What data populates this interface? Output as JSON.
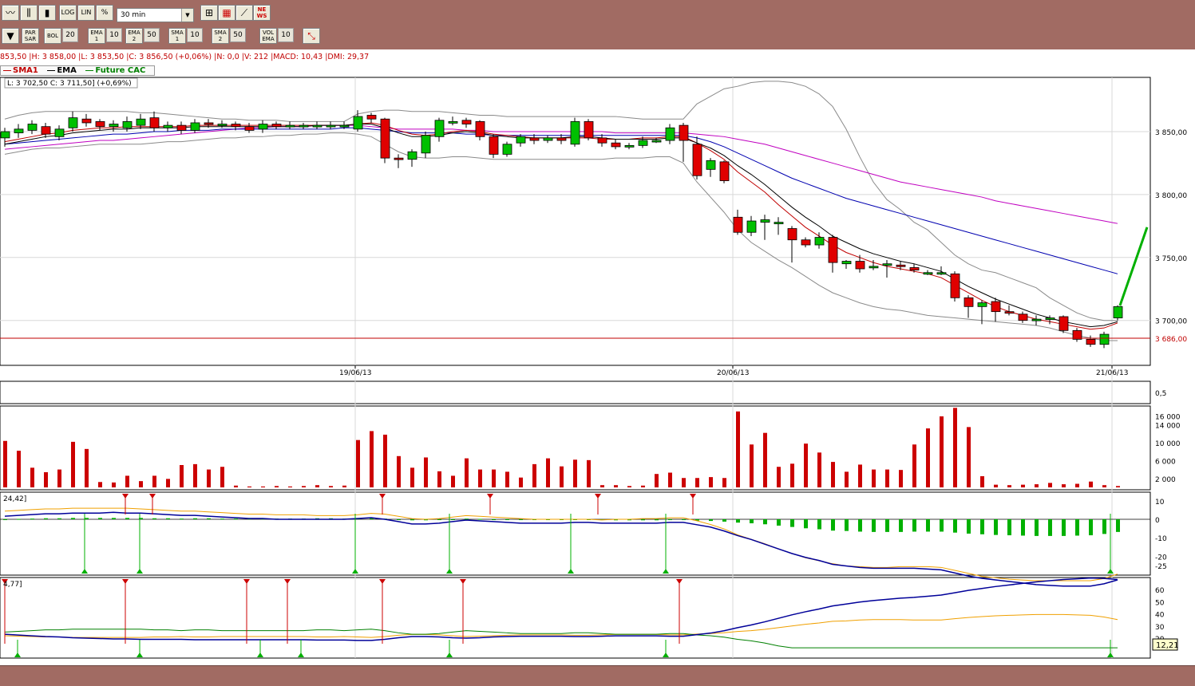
{
  "toolbar1": {
    "chart_type_icons": [
      "line-chart-icon",
      "bar-chart-icon",
      "candlestick-icon"
    ],
    "scale_buttons": [
      "LOG",
      "LIN",
      "%"
    ],
    "period": "30 min",
    "tool_icons": [
      "zoom-chart-icon",
      "color-grid-icon",
      "compare-chart-icon",
      "news-icon"
    ],
    "news_label": "NE WS"
  },
  "toolbar2": {
    "indicators": [
      {
        "label": "PAR SAR",
        "value": ""
      },
      {
        "label": "BOL",
        "value": "20"
      },
      {
        "label": "EMA 1",
        "value": "10"
      },
      {
        "label": "EMA 2",
        "value": "50"
      },
      {
        "label": "SMA 1",
        "value": "10"
      },
      {
        "label": "SMA 2",
        "value": "50"
      },
      {
        "label": "VOL EMA",
        "value": "10"
      }
    ]
  },
  "info_line": "853,50 |H: 3 858,00 |L: 3 853,50 |C: 3 856,50 (+0,06%) |N: 0,0 |V: 212 |MACD: 10,43 |DMI: 29,37",
  "legend": {
    "sma": "SMA1",
    "ema": "EMA",
    "future": "Future CAC"
  },
  "tooltip": "L: 3 702,50  C: 3 711,50] (+0,69%)",
  "colors": {
    "up": "#00c000",
    "down": "#e00000",
    "sma": "#c00000",
    "ema": "#000000",
    "ma50": "#c000c0",
    "ma_blue": "#0000b0",
    "macd": "#000099",
    "signal": "#f0a000",
    "dmi_plus": "#008000"
  },
  "price_axis": {
    "ticks": [
      "3 850,00",
      "3 800,00",
      "3 750,00",
      "3 700,00"
    ],
    "last_price": "3 686,00"
  },
  "dates": [
    "19/06/13",
    "20/06/13",
    "21/06/13"
  ],
  "osc_panel_label": "0,5",
  "volume_axis": [
    "16 000",
    "14 000",
    "10 000",
    "6 000",
    "2 000"
  ],
  "macd_panel": {
    "label": "24,42]",
    "ticks": [
      "10",
      "0",
      "-10",
      "-20",
      "-25"
    ]
  },
  "dmi_panel": {
    "label": "4,77]",
    "ticks": [
      "60",
      "50",
      "40",
      "30",
      "20"
    ],
    "value_box": "12,21"
  },
  "chart_data": {
    "type": "candlestick",
    "candles": [
      [
        3845,
        3850,
        3838,
        3853
      ],
      [
        3849,
        3852,
        3845,
        3856
      ],
      [
        3851,
        3856,
        3848,
        3859
      ],
      [
        3854,
        3848,
        3845,
        3857
      ],
      [
        3846,
        3852,
        3843,
        3855
      ],
      [
        3853,
        3861,
        3850,
        3866
      ],
      [
        3860,
        3857,
        3854,
        3864
      ],
      [
        3858,
        3854,
        3851,
        3860
      ],
      [
        3854,
        3856,
        3850,
        3859
      ],
      [
        3853,
        3858,
        3850,
        3862
      ],
      [
        3855,
        3860,
        3852,
        3864
      ],
      [
        3861,
        3853,
        3850,
        3866
      ],
      [
        3853,
        3855,
        3850,
        3858
      ],
      [
        3855,
        3851,
        3848,
        3858
      ],
      [
        3851,
        3857,
        3849,
        3860
      ],
      [
        3857,
        3856,
        3853,
        3860
      ],
      [
        3856,
        3856,
        3853,
        3859
      ],
      [
        3856,
        3854,
        3851,
        3858
      ],
      [
        3854,
        3851,
        3849,
        3857
      ],
      [
        3852,
        3856,
        3849,
        3859
      ],
      [
        3856,
        3854,
        3852,
        3858
      ],
      [
        3855,
        3855,
        3852,
        3858
      ],
      [
        3855,
        3855,
        3852,
        3857
      ],
      [
        3855,
        3855,
        3852,
        3858
      ],
      [
        3855,
        3855,
        3852,
        3858
      ],
      [
        3855,
        3855,
        3852,
        3858
      ],
      [
        3852,
        3862,
        3850,
        3867
      ],
      [
        3863,
        3860,
        3857,
        3865
      ],
      [
        3860,
        3829,
        3825,
        3861
      ],
      [
        3829,
        3828,
        3821,
        3832
      ],
      [
        3828,
        3834,
        3822,
        3836
      ],
      [
        3833,
        3847,
        3829,
        3850
      ],
      [
        3846,
        3859,
        3842,
        3861
      ],
      [
        3858,
        3858,
        3855,
        3862
      ],
      [
        3859,
        3856,
        3853,
        3861
      ],
      [
        3858,
        3846,
        3843,
        3859
      ],
      [
        3846,
        3832,
        3829,
        3848
      ],
      [
        3832,
        3840,
        3830,
        3842
      ],
      [
        3841,
        3846,
        3838,
        3848
      ],
      [
        3845,
        3843,
        3840,
        3848
      ],
      [
        3843,
        3845,
        3841,
        3847
      ],
      [
        3845,
        3843,
        3840,
        3848
      ],
      [
        3840,
        3858,
        3838,
        3861
      ],
      [
        3858,
        3845,
        3843,
        3860
      ],
      [
        3845,
        3841,
        3838,
        3848
      ],
      [
        3841,
        3838,
        3836,
        3844
      ],
      [
        3838,
        3839,
        3836,
        3841
      ],
      [
        3839,
        3843,
        3837,
        3846
      ],
      [
        3843,
        3843,
        3841,
        3845
      ],
      [
        3843,
        3853,
        3840,
        3856
      ],
      [
        3855,
        3843,
        3826,
        3857
      ],
      [
        3840,
        3815,
        3812,
        3846
      ],
      [
        3820,
        3827,
        3814,
        3829
      ],
      [
        3826,
        3811,
        3809,
        3827
      ],
      [
        3782,
        3770,
        3768,
        3788
      ],
      [
        3770,
        3779,
        3767,
        3783
      ],
      [
        3778,
        3780,
        3764,
        3784
      ],
      [
        3778,
        3778,
        3768,
        3782
      ],
      [
        3773,
        3764,
        3746,
        3775
      ],
      [
        3764,
        3760,
        3758,
        3766
      ],
      [
        3760,
        3766,
        3757,
        3770
      ],
      [
        3766,
        3746,
        3738,
        3768
      ],
      [
        3745,
        3747,
        3741,
        3748
      ],
      [
        3747,
        3741,
        3738,
        3752
      ],
      [
        3743,
        3743,
        3740,
        3748
      ],
      [
        3745,
        3745,
        3734,
        3748
      ],
      [
        3744,
        3743,
        3740,
        3747
      ],
      [
        3742,
        3740,
        3738,
        3745
      ],
      [
        3738,
        3738,
        3736,
        3740
      ],
      [
        3738,
        3738,
        3736,
        3743
      ],
      [
        3737,
        3718,
        3715,
        3739
      ],
      [
        3718,
        3711,
        3702,
        3720
      ],
      [
        3711,
        3714,
        3697,
        3716
      ],
      [
        3715,
        3707,
        3699,
        3718
      ],
      [
        3707,
        3706,
        3704,
        3712
      ],
      [
        3705,
        3700,
        3698,
        3707
      ],
      [
        3700,
        3701,
        3696,
        3704
      ],
      [
        3701,
        3702,
        3697,
        3704
      ],
      [
        3703,
        3692,
        3690,
        3704
      ],
      [
        3692,
        3685,
        3683,
        3694
      ],
      [
        3685,
        3681,
        3679,
        3688
      ],
      [
        3681,
        3689,
        3678,
        3691
      ],
      [
        3702,
        3711,
        3700,
        3712
      ]
    ],
    "volume": [
      10400,
      8200,
      4400,
      3400,
      4000,
      10200,
      8600,
      1200,
      1100,
      2600,
      1400,
      2600,
      1900,
      5000,
      5200,
      4000,
      4600,
      400,
      200,
      200,
      300,
      200,
      300,
      500,
      300,
      400,
      10600,
      12600,
      11800,
      7000,
      4400,
      6700,
      3600,
      2600,
      6500,
      4000,
      4000,
      3500,
      2200,
      5200,
      6500,
      4700,
      6200,
      6100,
      500,
      500,
      300,
      400,
      3000,
      3300,
      2100,
      2100,
      2300,
      2100,
      17000,
      9600,
      12200,
      4600,
      5300,
      9800,
      7800,
      5700,
      3500,
      5100,
      4000,
      4000,
      3900,
      9600,
      13200,
      15900,
      17800,
      13500,
      2500,
      600,
      500,
      600,
      700,
      1000,
      700,
      800,
      1300,
      500,
      300
    ],
    "bollinger_upper": [
      3860,
      3863,
      3865,
      3866,
      3866,
      3866,
      3866,
      3866,
      3866,
      3866,
      3865,
      3865,
      3864,
      3863,
      3862,
      3861,
      3860,
      3860,
      3859,
      3859,
      3859,
      3858,
      3858,
      3858,
      3858,
      3858,
      3864,
      3866,
      3867,
      3867,
      3866,
      3866,
      3866,
      3865,
      3864,
      3863,
      3863,
      3862,
      3862,
      3862,
      3862,
      3862,
      3862,
      3862,
      3862,
      3862,
      3861,
      3860,
      3860,
      3860,
      3860,
      3872,
      3878,
      3884,
      3886,
      3889,
      3890,
      3890,
      3889,
      3886,
      3880,
      3870,
      3852,
      3830,
      3810,
      3796,
      3788,
      3778,
      3772,
      3762,
      3752,
      3745,
      3740,
      3738,
      3734,
      3730,
      3726,
      3718,
      3712,
      3706,
      3702,
      3700,
      3700
    ],
    "bollinger_lower": [
      3832,
      3834,
      3836,
      3837,
      3837,
      3838,
      3839,
      3840,
      3840,
      3840,
      3840,
      3841,
      3842,
      3842,
      3843,
      3844,
      3845,
      3845,
      3846,
      3846,
      3847,
      3847,
      3848,
      3848,
      3849,
      3849,
      3848,
      3846,
      3840,
      3834,
      3830,
      3829,
      3829,
      3830,
      3830,
      3829,
      3828,
      3828,
      3828,
      3828,
      3828,
      3828,
      3828,
      3828,
      3828,
      3829,
      3829,
      3829,
      3830,
      3830,
      3825,
      3810,
      3798,
      3786,
      3772,
      3762,
      3755,
      3748,
      3742,
      3735,
      3728,
      3722,
      3718,
      3714,
      3711,
      3709,
      3708,
      3706,
      3704,
      3703,
      3702,
      3701,
      3700,
      3699,
      3698,
      3697,
      3696,
      3694,
      3691,
      3688,
      3686,
      3684,
      3684
    ],
    "sma_red": [
      3842,
      3844,
      3846,
      3848,
      3849,
      3851,
      3852,
      3853,
      3853,
      3854,
      3854,
      3854,
      3854,
      3854,
      3855,
      3855,
      3855,
      3855,
      3855,
      3855,
      3855,
      3855,
      3855,
      3855,
      3855,
      3855,
      3856,
      3857,
      3855,
      3851,
      3848,
      3847,
      3848,
      3850,
      3851,
      3850,
      3848,
      3847,
      3846,
      3845,
      3845,
      3845,
      3845,
      3845,
      3844,
      3844,
      3844,
      3845,
      3845,
      3846,
      3846,
      3841,
      3835,
      3828,
      3818,
      3810,
      3802,
      3792,
      3783,
      3774,
      3767,
      3760,
      3754,
      3750,
      3746,
      3743,
      3741,
      3739,
      3737,
      3734,
      3728,
      3722,
      3716,
      3711,
      3707,
      3704,
      3701,
      3699,
      3697,
      3695,
      3693,
      3694,
      3698
    ],
    "ema_black": [
      3840,
      3842,
      3844,
      3846,
      3847,
      3849,
      3850,
      3851,
      3852,
      3852,
      3853,
      3853,
      3853,
      3853,
      3854,
      3854,
      3854,
      3854,
      3854,
      3854,
      3854,
      3854,
      3854,
      3855,
      3855,
      3855,
      3856,
      3856,
      3853,
      3849,
      3846,
      3846,
      3847,
      3849,
      3850,
      3849,
      3847,
      3846,
      3845,
      3845,
      3845,
      3845,
      3846,
      3846,
      3845,
      3844,
      3844,
      3844,
      3844,
      3845,
      3845,
      3841,
      3837,
      3831,
      3823,
      3816,
      3808,
      3799,
      3790,
      3782,
      3775,
      3767,
      3762,
      3757,
      3753,
      3750,
      3747,
      3745,
      3742,
      3739,
      3733,
      3727,
      3722,
      3717,
      3713,
      3709,
      3705,
      3702,
      3699,
      3697,
      3695,
      3696,
      3699
    ],
    "ma_magenta": [
      3836,
      3837,
      3838,
      3839,
      3840,
      3841,
      3842,
      3843,
      3843,
      3844,
      3845,
      3846,
      3847,
      3848,
      3849,
      3850,
      3851,
      3852,
      3853,
      3853,
      3854,
      3854,
      3854,
      3855,
      3855,
      3855,
      3855,
      3854,
      3853,
      3852,
      3852,
      3852,
      3852,
      3852,
      3851,
      3851,
      3850,
      3850,
      3850,
      3850,
      3850,
      3850,
      3850,
      3850,
      3850,
      3849,
      3849,
      3849,
      3849,
      3849,
      3849,
      3848,
      3847,
      3846,
      3844,
      3842,
      3840,
      3837,
      3834,
      3831,
      3828,
      3825,
      3822,
      3819,
      3816,
      3813,
      3810,
      3808,
      3806,
      3804,
      3802,
      3800,
      3798,
      3795,
      3793,
      3791,
      3789,
      3787,
      3785,
      3783,
      3781,
      3779,
      3777
    ],
    "ma_blue": [
      3840,
      3841,
      3842,
      3843,
      3844,
      3845,
      3846,
      3847,
      3848,
      3848,
      3849,
      3850,
      3850,
      3851,
      3851,
      3851,
      3852,
      3852,
      3852,
      3852,
      3852,
      3852,
      3852,
      3852,
      3852,
      3853,
      3853,
      3852,
      3851,
      3850,
      3849,
      3849,
      3849,
      3849,
      3848,
      3848,
      3847,
      3847,
      3847,
      3847,
      3847,
      3847,
      3847,
      3847,
      3847,
      3847,
      3847,
      3847,
      3847,
      3847,
      3847,
      3845,
      3842,
      3838,
      3833,
      3828,
      3823,
      3818,
      3813,
      3809,
      3805,
      3801,
      3797,
      3794,
      3791,
      3788,
      3785,
      3782,
      3779,
      3776,
      3773,
      3770,
      3767,
      3764,
      3761,
      3758,
      3755,
      3752,
      3749,
      3746,
      3743,
      3740,
      3737
    ],
    "projection": [
      3708,
      3774
    ]
  }
}
